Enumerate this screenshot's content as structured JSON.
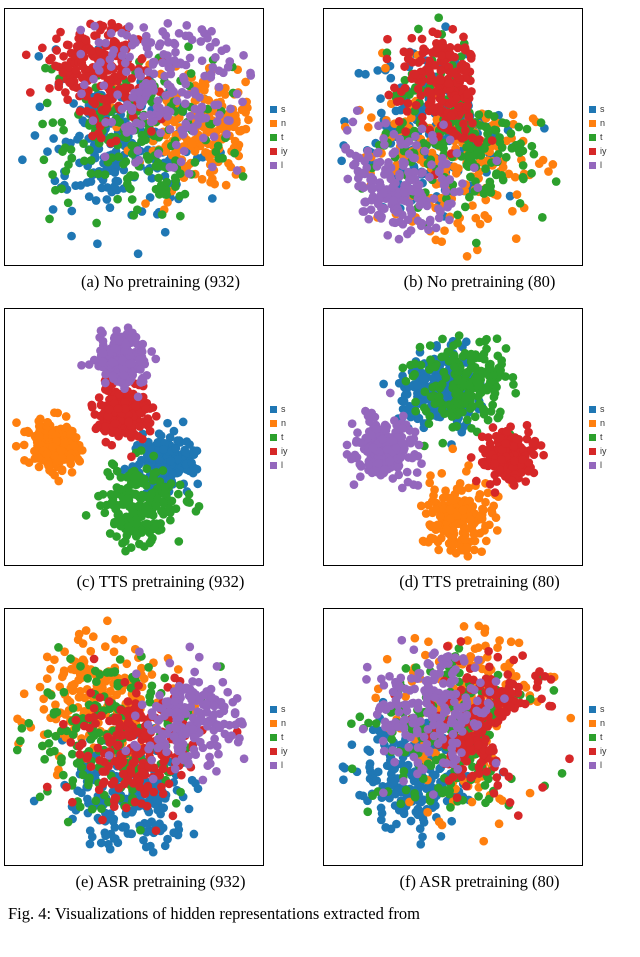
{
  "legend_labels": [
    "s",
    "n",
    "t",
    "iy",
    "l"
  ],
  "colors": {
    "s": "#1f77b4",
    "n": "#ff7f0e",
    "t": "#2ca02c",
    "iy": "#d62728",
    "l": "#9467bd"
  },
  "panels": [
    {
      "id": "a",
      "caption": "(a) No pretraining (932)",
      "seed": 932,
      "mode": "none"
    },
    {
      "id": "b",
      "caption": "(b) No pretraining (80)",
      "seed": 80,
      "mode": "none_gap"
    },
    {
      "id": "c",
      "caption": "(c) TTS pretraining (932)",
      "seed": 933,
      "mode": "tts_a"
    },
    {
      "id": "d",
      "caption": "(d) TTS pretraining (80)",
      "seed": 81,
      "mode": "tts_b"
    },
    {
      "id": "e",
      "caption": "(e) ASR pretraining (932)",
      "seed": 934,
      "mode": "asr"
    },
    {
      "id": "f",
      "caption": "(f) ASR pretraining (80)",
      "seed": 82,
      "mode": "asr_gap"
    }
  ],
  "chart_data": [
    {
      "type": "scatter",
      "title": "No pretraining (932)",
      "xlim": [
        -1,
        1
      ],
      "ylim": [
        -1,
        1
      ],
      "n_per_class": 200,
      "series": [
        {
          "name": "s",
          "centroid": [
            -0.1,
            -0.1
          ],
          "spread": 0.9
        },
        {
          "name": "n",
          "centroid": [
            0.55,
            0.05
          ],
          "spread": 0.7
        },
        {
          "name": "t",
          "centroid": [
            0.0,
            0.0
          ],
          "spread": 1.0
        },
        {
          "name": "iy",
          "centroid": [
            -0.25,
            0.55
          ],
          "spread": 0.6
        },
        {
          "name": "l",
          "centroid": [
            0.25,
            0.45
          ],
          "spread": 0.9
        }
      ],
      "notes": "points fill a roughly square region, classes heavily overlapping"
    },
    {
      "type": "scatter",
      "title": "No pretraining (80)",
      "xlim": [
        -1,
        1
      ],
      "ylim": [
        -1,
        1
      ],
      "n_per_class": 200,
      "series": [
        {
          "name": "s",
          "centroid": [
            -0.15,
            0.05
          ],
          "spread": 0.9
        },
        {
          "name": "n",
          "centroid": [
            0.0,
            -0.1
          ],
          "spread": 1.0
        },
        {
          "name": "t",
          "centroid": [
            0.1,
            0.1
          ],
          "spread": 0.9
        },
        {
          "name": "iy",
          "centroid": [
            0.0,
            0.4
          ],
          "spread": 0.6
        },
        {
          "name": "l",
          "centroid": [
            -0.5,
            -0.4
          ],
          "spread": 0.7
        }
      ],
      "notes": "C-shaped cloud with a large void upper-right; classes overlapping"
    },
    {
      "type": "scatter",
      "title": "TTS pretraining (932)",
      "xlim": [
        -1,
        1
      ],
      "ylim": [
        -1,
        1
      ],
      "n_per_class": 200,
      "series": [
        {
          "name": "s",
          "centroid": [
            0.25,
            -0.2
          ],
          "spread": 0.35
        },
        {
          "name": "n",
          "centroid": [
            -0.65,
            -0.05
          ],
          "spread": 0.3
        },
        {
          "name": "t",
          "centroid": [
            0.05,
            -0.55
          ],
          "spread": 0.45
        },
        {
          "name": "iy",
          "centroid": [
            -0.1,
            0.2
          ],
          "spread": 0.3
        },
        {
          "name": "l",
          "centroid": [
            -0.1,
            0.65
          ],
          "spread": 0.3
        }
      ],
      "notes": "well-separated compact clusters per class"
    },
    {
      "type": "scatter",
      "title": "TTS pretraining (80)",
      "xlim": [
        -1,
        1
      ],
      "ylim": [
        -1,
        1
      ],
      "n_per_class": 200,
      "series": [
        {
          "name": "s",
          "centroid": [
            -0.1,
            0.4
          ],
          "spread": 0.45
        },
        {
          "name": "n",
          "centroid": [
            0.05,
            -0.65
          ],
          "spread": 0.4
        },
        {
          "name": "t",
          "centroid": [
            0.1,
            0.45
          ],
          "spread": 0.55
        },
        {
          "name": "iy",
          "centroid": [
            0.45,
            -0.15
          ],
          "spread": 0.3
        },
        {
          "name": "l",
          "centroid": [
            -0.55,
            -0.1
          ],
          "spread": 0.35
        }
      ],
      "notes": "separated clusters, some t/s overlap at top"
    },
    {
      "type": "scatter",
      "title": "ASR pretraining (932)",
      "xlim": [
        -1,
        1
      ],
      "ylim": [
        -1,
        1
      ],
      "n_per_class": 200,
      "series": [
        {
          "name": "s",
          "centroid": [
            0.0,
            -0.5
          ],
          "spread": 0.7
        },
        {
          "name": "n",
          "centroid": [
            -0.3,
            0.3
          ],
          "spread": 0.8
        },
        {
          "name": "t",
          "centroid": [
            -0.2,
            0.0
          ],
          "spread": 0.9
        },
        {
          "name": "iy",
          "centroid": [
            0.0,
            -0.1
          ],
          "spread": 0.7
        },
        {
          "name": "l",
          "centroid": [
            0.45,
            0.15
          ],
          "spread": 0.6
        }
      ],
      "notes": "circular cloud, classes partially separated but overlapping"
    },
    {
      "type": "scatter",
      "title": "ASR pretraining (80)",
      "xlim": [
        -1,
        1
      ],
      "ylim": [
        -1,
        1
      ],
      "n_per_class": 200,
      "series": [
        {
          "name": "s",
          "centroid": [
            -0.35,
            -0.35
          ],
          "spread": 0.7
        },
        {
          "name": "n",
          "centroid": [
            0.15,
            0.15
          ],
          "spread": 0.9
        },
        {
          "name": "t",
          "centroid": [
            0.0,
            0.0
          ],
          "spread": 0.9
        },
        {
          "name": "iy",
          "centroid": [
            0.35,
            0.1
          ],
          "spread": 0.7
        },
        {
          "name": "l",
          "centroid": [
            -0.15,
            0.2
          ],
          "spread": 0.7
        }
      ],
      "notes": "tilted C-shape with void right-center; overlapping classes"
    }
  ],
  "figure_caption_prefix": "Fig. 4: Visualizations of hidden representations extracted from"
}
